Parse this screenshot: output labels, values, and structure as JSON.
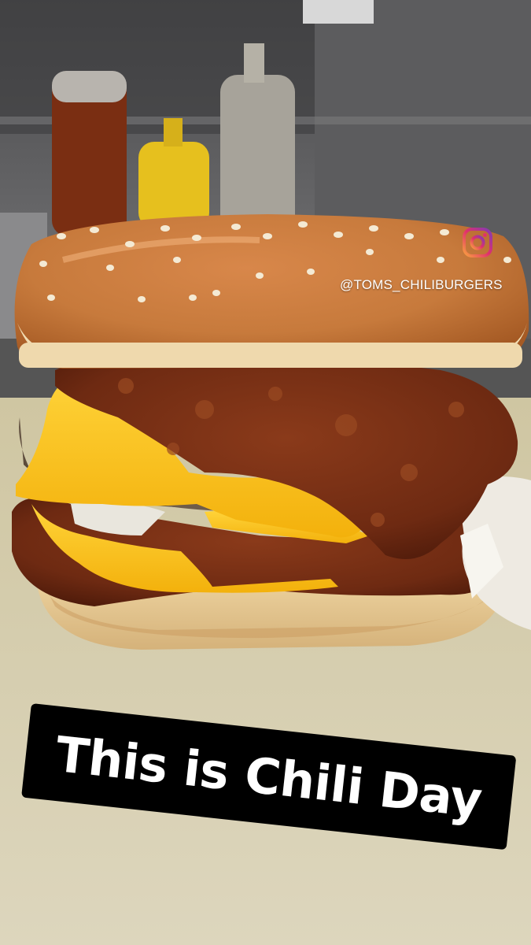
{
  "story": {
    "handle": "@TOMS_CHILIBURGERS",
    "caption": "This is Chili Day",
    "icon": "instagram-icon"
  },
  "colors": {
    "caption_bg": "#000000",
    "caption_text": "#ffffff",
    "instagram_gradient_start": "#f9a03f",
    "instagram_gradient_mid": "#e1306c",
    "instagram_gradient_end": "#833ab4"
  }
}
